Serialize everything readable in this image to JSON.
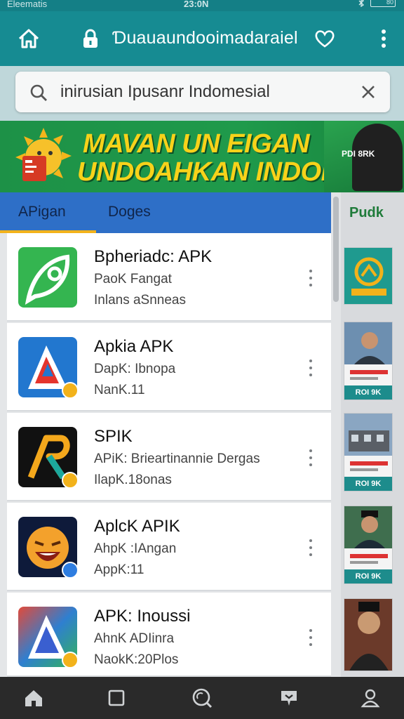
{
  "status_bar": {
    "carrier": "Eleematis",
    "time": "23:0N",
    "battery": "80"
  },
  "topbar": {
    "url_text": "Ɗuauaundooimadaraiel"
  },
  "search": {
    "value": "inirusian Ipusanr Indomesial"
  },
  "banner": {
    "line1": "MAVAN UN EIGAN",
    "line2": "UNDOAHKAN INDONESIA",
    "side_text": "PDI 8RK"
  },
  "tabs": [
    {
      "label": "APigan",
      "active": true
    },
    {
      "label": "Doges",
      "active": false
    }
  ],
  "right_panel": {
    "label": "Pudk",
    "card_strips": [
      "ROI 9K",
      "ROI 9K",
      "ROI 9K"
    ]
  },
  "apps": [
    {
      "title": "Bpheriadc: APK",
      "line1": "PaoK Fangat",
      "line2": "Inlans aSnneas",
      "icon": "leaf-icon"
    },
    {
      "title": "Apkia APK",
      "line1": "DapK: Ibnopa",
      "line2": "NanK.11",
      "icon": "triangle-a-icon"
    },
    {
      "title": "SPIK",
      "line1": "APiK: Brieartinannie Dergas",
      "line2": "IlapK.18onas",
      "icon": "r-letter-icon"
    },
    {
      "title": "AplcK APIK",
      "line1": "AhpK :IAngan",
      "line2": "AppK:11",
      "icon": "laughing-face-icon"
    },
    {
      "title": "APK: Inoussi",
      "line1": "AhnK ADIinra",
      "line2": "NaokK:20Plos",
      "icon": "triangle-a-icon"
    }
  ],
  "colors": {
    "topbar": "#168b92",
    "banner": "#1f9a4b",
    "tabs": "#2e6fc7",
    "accent": "#f2b21b"
  }
}
